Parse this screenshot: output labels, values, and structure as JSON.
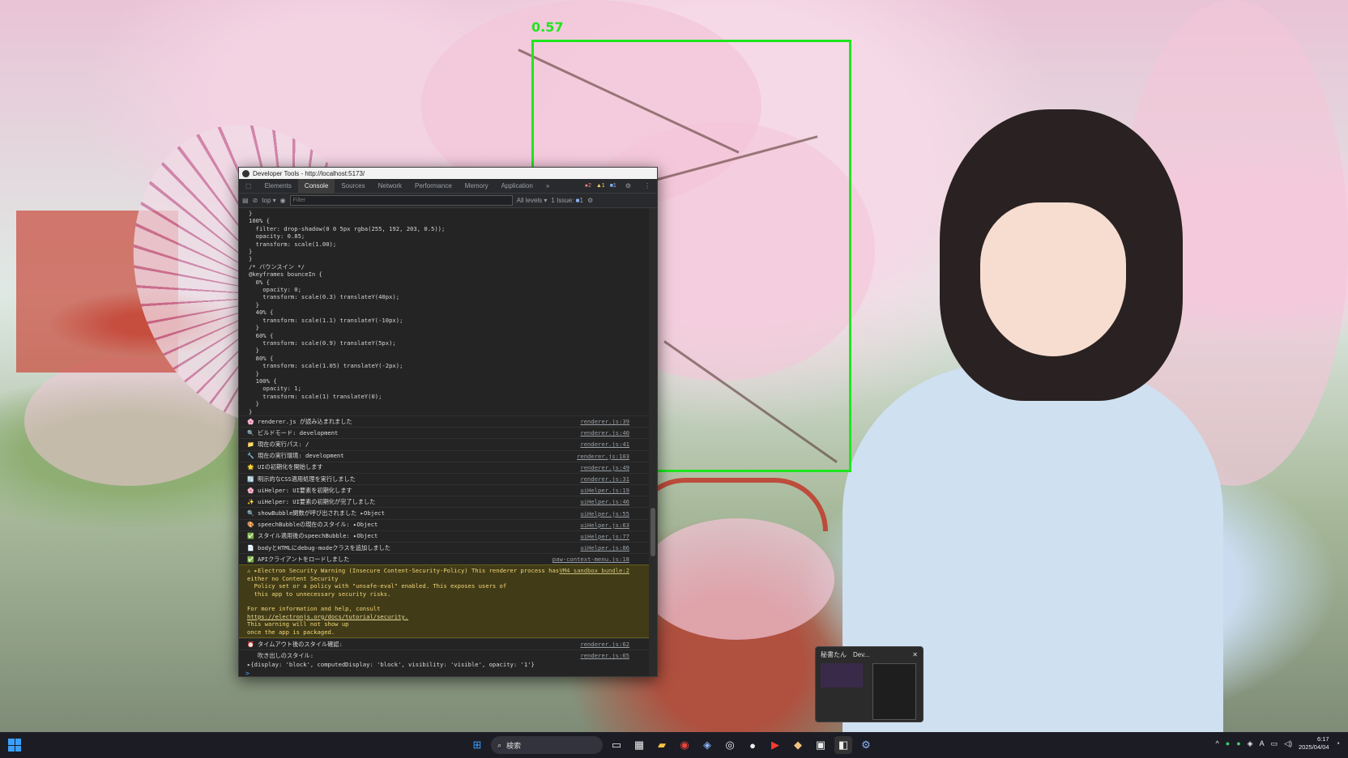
{
  "detection": {
    "label": "0.57"
  },
  "devtools": {
    "title": "Developer Tools - http://localhost:5173/",
    "tabs": [
      "Elements",
      "Console",
      "Sources",
      "Network",
      "Performance",
      "Memory",
      "Application"
    ],
    "more_tabs": "»",
    "badges": {
      "errors": "2",
      "warnings": "1",
      "messages": "1"
    },
    "toolbar": {
      "context": "top ▾",
      "filter_placeholder": "Filter",
      "levels": "All levels ▾",
      "issues": "1 Issue:",
      "issues_count": "1"
    },
    "code": "}\n100% {\n  filter: drop-shadow(0 0 5px rgba(255, 192, 203, 0.5));\n  opacity: 0.85;\n  transform: scale(1.00);\n}\n}\n/* バウンスイン */\n@keyframes bounceIn {\n  0% {\n    opacity: 0;\n    transform: scale(0.3) translateY(40px);\n  }\n  40% {\n    transform: scale(1.1) translateY(-10px);\n  }\n  60% {\n    transform: scale(0.9) translateY(5px);\n  }\n  80% {\n    transform: scale(1.05) translateY(-2px);\n  }\n  100% {\n    opacity: 1;\n    transform: scale(1) translateY(0);\n  }\n}",
    "logs": [
      {
        "icon": "🌸",
        "text": "renderer.js が読み込まれました",
        "src": "renderer.js:39"
      },
      {
        "icon": "🔍",
        "text": "ビルドモード: development",
        "src": "renderer.js:40"
      },
      {
        "icon": "📁",
        "text": "現在の実行パス: /",
        "src": "renderer.js:41"
      },
      {
        "icon": "🔧",
        "text": "現在の実行環境: development",
        "src": "renderer.js:103"
      },
      {
        "icon": "🌟",
        "text": "UIの初期化を開始します",
        "src": "renderer.js:49"
      },
      {
        "icon": "🔄",
        "text": "明示的なCSS適用処理を実行しました",
        "src": "renderer.js:31"
      },
      {
        "icon": "🌸",
        "text": "uiHelper: UI要素を初期化します",
        "src": "uiHelper.js:19"
      },
      {
        "icon": "✨",
        "text": "uiHelper: UI要素の初期化が完了しました",
        "src": "uiHelper.js:46"
      },
      {
        "icon": "🔍",
        "text": "showBubble関数が呼び出されました ▸Object",
        "src": "uiHelper.js:55"
      },
      {
        "icon": "🎨",
        "text": "speechBubbleの現在のスタイル: ▸Object",
        "src": "uiHelper.js:63"
      },
      {
        "icon": "✅",
        "text": "スタイル適用後のspeechBubble: ▸Object",
        "src": "uiHelper.js:77"
      },
      {
        "icon": "📄",
        "text": "bodyとHTMLにdebug-modeクラスを追加しました",
        "src": "uiHelper.js:86"
      },
      {
        "icon": "✅",
        "text": "APIクライアントをロードしました",
        "src": "paw-context-menu.js:18"
      }
    ],
    "warning": {
      "icon": "⚠",
      "text": "▸Electron Security Warning (Insecure Content-Security-Policy) This renderer process has\neither no Content Security\n  Policy set or a policy with \"unsafe-eval\" enabled. This exposes users of\n  this app to unnecessary security risks.\n\nFor more information and help, consult",
      "link": "https://electronjs.org/docs/tutorial/security.",
      "tail": "This warning will not show up\nonce the app is packaged.",
      "src": "VM4 sandbox_bundle:2"
    },
    "logs2": [
      {
        "icon": "⏰",
        "text": "タイムアウト後のスタイル確認:",
        "src": "renderer.js:62"
      },
      {
        "icon": "",
        "text": "吹き出しのスタイル:",
        "src": "renderer.js:65"
      }
    ],
    "obj_line": "▸{display: 'block', computedDisplay: 'block', visibility: 'visible', opacity: '1'}",
    "prompt": ">"
  },
  "preview": {
    "tab1": "秘書たん",
    "tab2": "Dev...",
    "close": "✕"
  },
  "taskbar": {
    "search_placeholder": "検索",
    "time": "6:17",
    "date": "2025/04/04",
    "ime": "A"
  }
}
